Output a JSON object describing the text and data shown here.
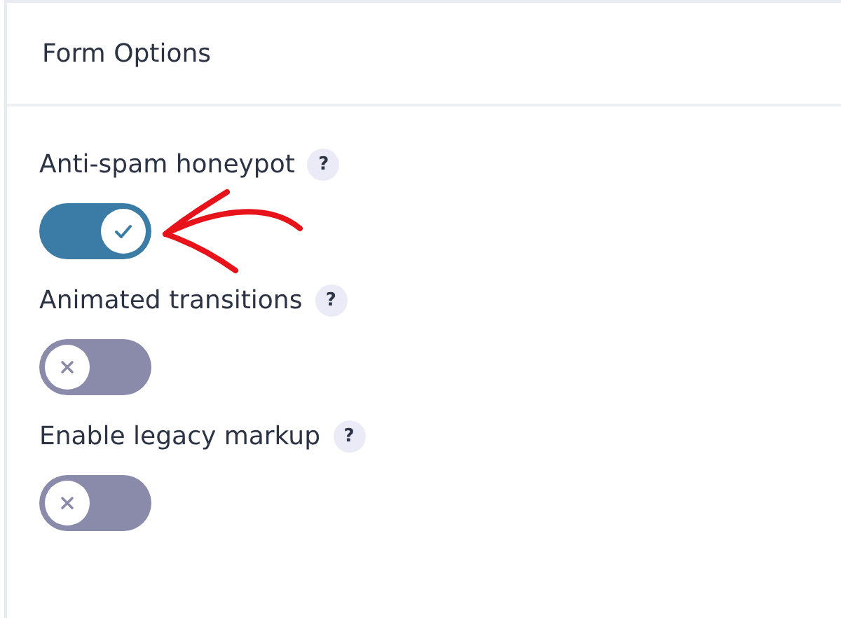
{
  "panel": {
    "title": "Form Options"
  },
  "options": [
    {
      "label": "Anti-spam honeypot",
      "help": "?",
      "on": true,
      "highlighted": true
    },
    {
      "label": "Animated transitions",
      "help": "?",
      "on": false,
      "highlighted": false
    },
    {
      "label": "Enable legacy markup",
      "help": "?",
      "on": false,
      "highlighted": false
    }
  ]
}
